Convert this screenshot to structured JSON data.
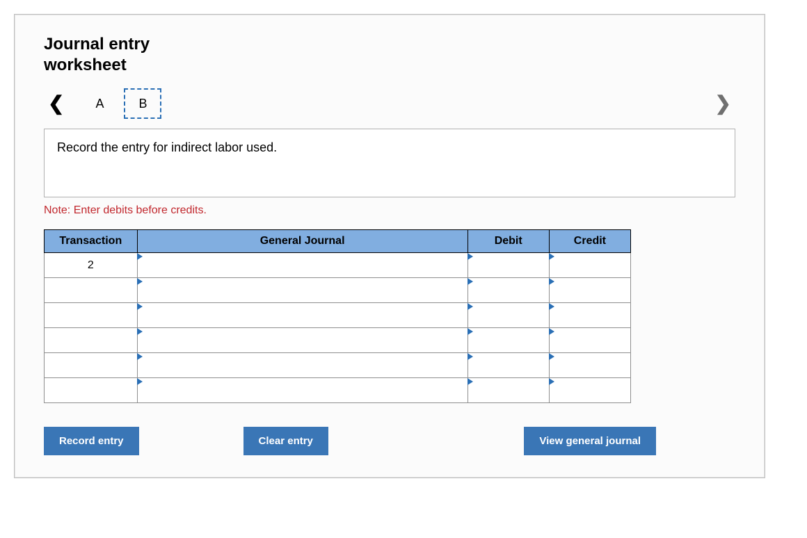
{
  "title_line1": "Journal entry",
  "title_line2": "worksheet",
  "tabs": {
    "a": "A",
    "b": "B"
  },
  "prompt": "Record the entry for indirect labor used.",
  "note": "Note: Enter debits before credits.",
  "headers": {
    "transaction": "Transaction",
    "general_journal": "General Journal",
    "debit": "Debit",
    "credit": "Credit"
  },
  "rows": [
    {
      "transaction": "2",
      "gj": "",
      "debit": "",
      "credit": ""
    },
    {
      "transaction": "",
      "gj": "",
      "debit": "",
      "credit": ""
    },
    {
      "transaction": "",
      "gj": "",
      "debit": "",
      "credit": ""
    },
    {
      "transaction": "",
      "gj": "",
      "debit": "",
      "credit": ""
    },
    {
      "transaction": "",
      "gj": "",
      "debit": "",
      "credit": ""
    },
    {
      "transaction": "",
      "gj": "",
      "debit": "",
      "credit": ""
    }
  ],
  "buttons": {
    "record": "Record entry",
    "clear": "Clear entry",
    "view": "View general journal"
  }
}
